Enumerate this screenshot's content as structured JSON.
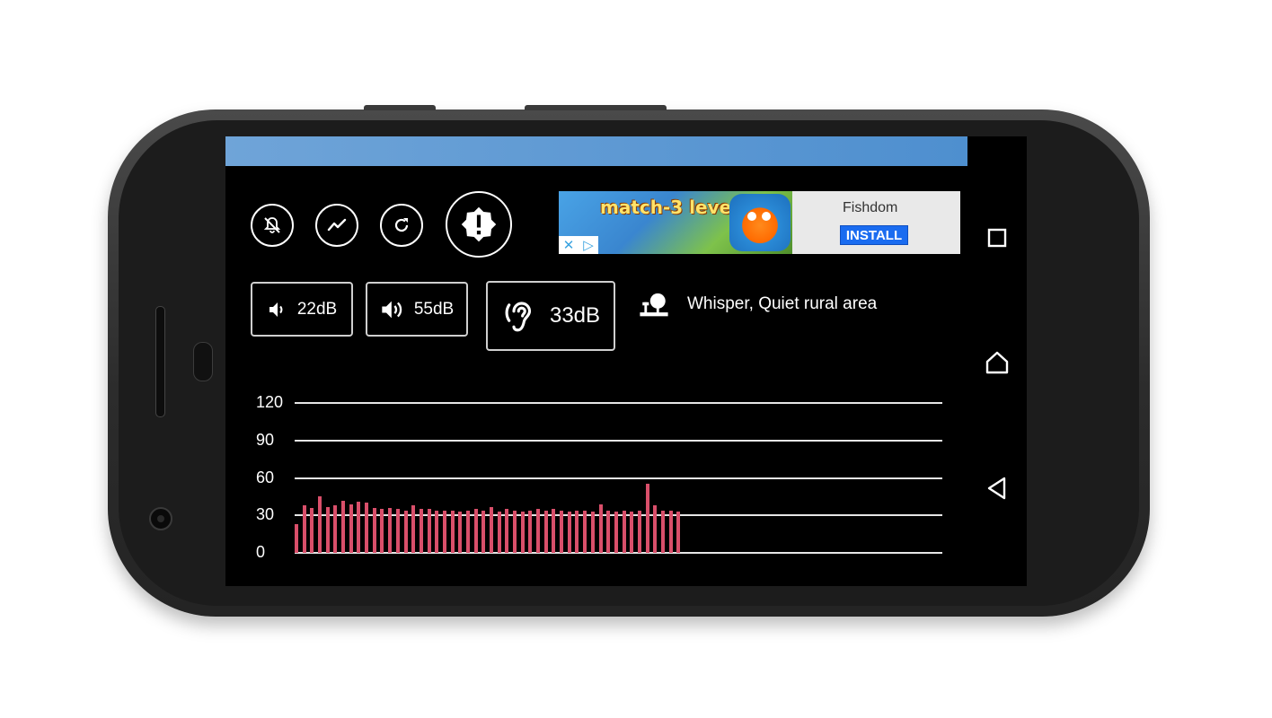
{
  "app": {
    "controls": [
      {
        "name": "notification-off-button",
        "icon": "notification-off-icon"
      },
      {
        "name": "trend-button",
        "icon": "trend-icon"
      },
      {
        "name": "refresh-button",
        "icon": "refresh-icon"
      },
      {
        "name": "alert-button",
        "icon": "alert-icon"
      }
    ],
    "ad": {
      "headline": "match-3 level",
      "title": "Fishdom",
      "install_label": "INSTALL",
      "choices": [
        "✕",
        "▷"
      ]
    },
    "min_db": {
      "value": "22dB",
      "icon": "volume-low-icon"
    },
    "max_db": {
      "value": "55dB",
      "icon": "volume-high-icon"
    },
    "current_db": {
      "value": "33dB",
      "icon": "ear-icon"
    },
    "level_description": {
      "text": "Whisper, Quiet rural area",
      "icon": "reference-level-icon"
    }
  },
  "nav": {
    "recent_icon": "recents-square-icon",
    "home_icon": "home-icon",
    "back_icon": "back-triangle-icon"
  },
  "chart_data": {
    "type": "bar",
    "title": "",
    "xlabel": "",
    "ylabel": "",
    "ylim": [
      0,
      120
    ],
    "y_ticks": [
      "0",
      "30",
      "60",
      "90",
      "120"
    ],
    "grid": true,
    "bar_color": "#d94f6a",
    "values": [
      23,
      38,
      36,
      45,
      37,
      38,
      42,
      39,
      41,
      40,
      36,
      35,
      36,
      35,
      34,
      38,
      35,
      35,
      34,
      34,
      34,
      33,
      34,
      35,
      34,
      37,
      33,
      35,
      34,
      33,
      34,
      35,
      34,
      35,
      34,
      33,
      34,
      34,
      33,
      39,
      34,
      33,
      34,
      33,
      34,
      55,
      38,
      34,
      34,
      33
    ]
  }
}
